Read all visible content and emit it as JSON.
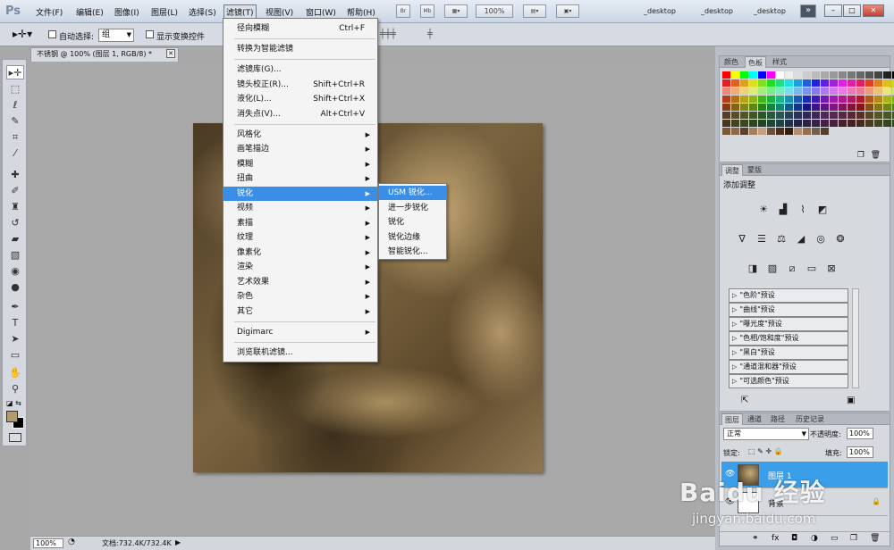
{
  "app": {
    "logo": "Ps"
  },
  "menubar": {
    "items": [
      "文件(F)",
      "编辑(E)",
      "图像(I)",
      "图层(L)",
      "选择(S)",
      "滤镜(T)",
      "视图(V)",
      "窗口(W)",
      "帮助(H)"
    ],
    "app_buttons": [
      "Br",
      "Mb"
    ],
    "zoom": "100%",
    "workspaces": [
      "_desktop",
      "_desktop",
      "_desktop"
    ],
    "more": "»",
    "window_controls": {
      "minimize": "–",
      "restore": "□",
      "close": "✕"
    }
  },
  "options": {
    "auto_select_label": "自动选择:",
    "auto_select_value": "组",
    "show_transform_label": "显示变换控件"
  },
  "document": {
    "tab_title": "不锈钢 @ 100% (图层 1, RGB/8) *",
    "close": "✕"
  },
  "filter_menu": {
    "items": [
      {
        "label": "径向模糊",
        "shortcut": "Ctrl+F"
      },
      {
        "label": "转换为智能滤镜",
        "shortcut": ""
      },
      {
        "label": "滤镜库(G)...",
        "shortcut": ""
      },
      {
        "label": "镜头校正(R)...",
        "shortcut": "Shift+Ctrl+R"
      },
      {
        "label": "液化(L)...",
        "shortcut": "Shift+Ctrl+X"
      },
      {
        "label": "消失点(V)...",
        "shortcut": "Alt+Ctrl+V"
      },
      {
        "label": "风格化",
        "shortcut": "",
        "sub": true
      },
      {
        "label": "画笔描边",
        "shortcut": "",
        "sub": true
      },
      {
        "label": "模糊",
        "shortcut": "",
        "sub": true
      },
      {
        "label": "扭曲",
        "shortcut": "",
        "sub": true
      },
      {
        "label": "锐化",
        "shortcut": "",
        "sub": true
      },
      {
        "label": "视频",
        "shortcut": "",
        "sub": true
      },
      {
        "label": "素描",
        "shortcut": "",
        "sub": true
      },
      {
        "label": "纹理",
        "shortcut": "",
        "sub": true
      },
      {
        "label": "像素化",
        "shortcut": "",
        "sub": true
      },
      {
        "label": "渲染",
        "shortcut": "",
        "sub": true
      },
      {
        "label": "艺术效果",
        "shortcut": "",
        "sub": true
      },
      {
        "label": "杂色",
        "shortcut": "",
        "sub": true
      },
      {
        "label": "其它",
        "shortcut": "",
        "sub": true
      },
      {
        "label": "Digimarc",
        "shortcut": "",
        "sub": true
      },
      {
        "label": "浏览联机滤镜...",
        "shortcut": ""
      }
    ],
    "submenu": [
      "USM 锐化...",
      "进一步锐化",
      "锐化",
      "锐化边缘",
      "智能锐化..."
    ]
  },
  "status": {
    "zoom": "100%",
    "doc": "文档:732.4K/732.4K"
  },
  "panels": {
    "swatches_tabs": [
      "颜色",
      "色板",
      "样式"
    ],
    "adjust_tabs": [
      "调整",
      "蒙版"
    ],
    "adjust_title": "添加调整",
    "presets": [
      "\"色阶\"预设",
      "\"曲线\"预设",
      "\"曝光度\"预设",
      "\"色相/饱和度\"预设",
      "\"黑白\"预设",
      "\"通道混和器\"预设",
      "\"可选颜色\"预设"
    ],
    "layers_tabs": [
      "图层",
      "通道",
      "路径",
      "历史记录"
    ],
    "blend_mode": "正常",
    "opacity_label": "不透明度:",
    "opacity_value": "100%",
    "lock_label": "锁定:",
    "fill_label": "填充:",
    "fill_value": "100%",
    "layers": [
      "图层 1",
      "背景"
    ]
  },
  "watermark": {
    "main": "Baidu 经验",
    "sub": "jingyan.baidu.com"
  }
}
